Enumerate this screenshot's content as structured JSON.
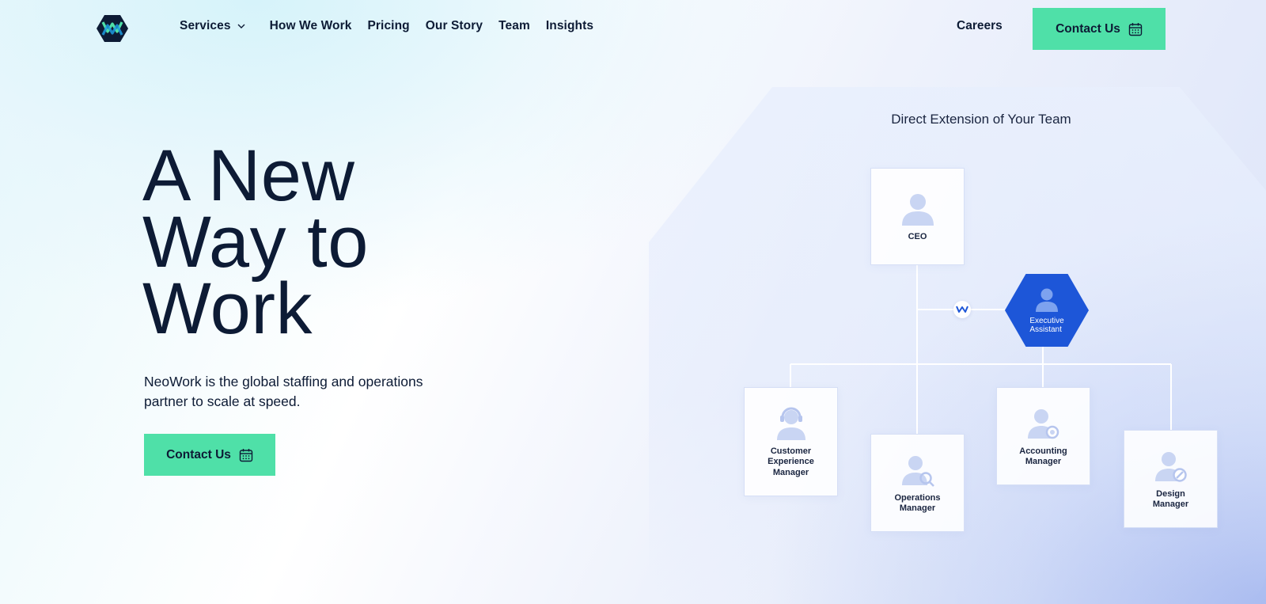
{
  "nav": {
    "logo_alt": "NeoWork logo",
    "items": [
      {
        "label": "Services",
        "has_dropdown": true
      },
      {
        "label": "How We Work"
      },
      {
        "label": "Pricing"
      },
      {
        "label": "Our Story"
      },
      {
        "label": "Team"
      },
      {
        "label": "Insights"
      }
    ],
    "careers": "Careers",
    "contact": "Contact Us"
  },
  "hero": {
    "title_lines": [
      "A New",
      "Way to",
      "Work"
    ],
    "subtitle": "NeoWork is the global staffing and operations partner to scale at speed.",
    "cta": "Contact Us"
  },
  "org_chart": {
    "title": "Direct Extension of Your Team",
    "ceo": "CEO",
    "assistant": [
      "Executive",
      "Assistant"
    ],
    "reports": {
      "cx": [
        "Customer",
        "Experience",
        "Manager"
      ],
      "ops": [
        "Operations",
        "Manager"
      ],
      "acc": [
        "Accounting",
        "Manager"
      ],
      "des": [
        "Design",
        "Manager"
      ]
    }
  },
  "colors": {
    "accent": "#4fe0a8",
    "text": "#0d1b35",
    "assistant_blue": "#1d56d8",
    "icon_light": "#c9d5f3"
  },
  "icons": {
    "calendar": "calendar-icon",
    "chevron": "chevron-down-icon",
    "person": "person-icon"
  }
}
